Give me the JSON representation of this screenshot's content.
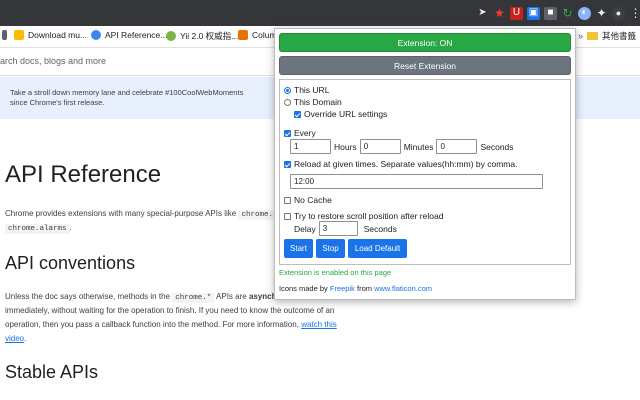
{
  "browser": {
    "bookmarks": [
      {
        "label": "",
        "icon": "bookmark-icon"
      },
      {
        "label": "Download mu...",
        "icon": "download-icon"
      },
      {
        "label": "API Reference...",
        "icon": "chrome-icon"
      },
      {
        "label": "Yii 2.0 权威指...",
        "icon": "yii-icon"
      },
      {
        "label": "Colum",
        "icon": "column-icon"
      }
    ],
    "other_bookmarks": "其他書籤"
  },
  "page": {
    "search_placeholder": "arch docs, blogs and more",
    "banner_text": "Take a stroll down memory lane and celebrate #100CoolWebMoments since Chrome's first release.",
    "h1": "API Reference",
    "intro_before": "Chrome provides extensions with many special-purpose APIs like",
    "intro_code1": "chrome.",
    "intro_code2": "chrome.alarms",
    "intro_after": ".",
    "h2_conventions": "API conventions",
    "conv_p1_a": "Unless the doc says otherwise, methods in the",
    "conv_code": "chrome.*",
    "conv_p1_b": "APIs are",
    "conv_bold": "asynch",
    "conv_p2": "immediately, without waiting for the operation to finish. If you need to know the outcome of an",
    "conv_p3": "operation, then you pass a callback function into the method. For more information,",
    "conv_link": "watch this",
    "conv_p4_link": "video",
    "conv_p4_end": ".",
    "h2_stable": "Stable APIs"
  },
  "popup": {
    "extension_button": "Extension: ON",
    "reset_button": "Reset Extension",
    "scope_options": [
      {
        "label": "This URL",
        "selected": true
      },
      {
        "label": "This Domain",
        "selected": false
      }
    ],
    "override_label": "Override URL settings",
    "override_checked": true,
    "every_label": "Every",
    "every_checked": true,
    "hours_value": "1",
    "hours_label": "Hours",
    "minutes_value": "0",
    "minutes_label": "Minutes",
    "seconds_value": "0",
    "seconds_label": "Seconds",
    "reload_times_label": "Reload at given times. Separate values(hh:mm) by comma.",
    "reload_times_checked": true,
    "reload_times_value": "12:00",
    "no_cache_label": "No Cache",
    "no_cache_checked": false,
    "restore_scroll_label": "Try to restore scroll position after reload",
    "restore_scroll_checked": false,
    "delay_label": "Delay",
    "delay_value": "3",
    "delay_unit": "Seconds",
    "start_button": "Start",
    "stop_button": "Stop",
    "load_default_button": "Load Default",
    "status_text": "Extension is enabled on this page",
    "credits_prefix": "Icons made by",
    "credits_author": "Freepik",
    "credits_from": "from",
    "credits_site": "www.flaticon.com"
  },
  "colors": {
    "on_green": "#28a745",
    "reset_gray": "#6c757d",
    "primary_blue": "#1a73e8"
  }
}
